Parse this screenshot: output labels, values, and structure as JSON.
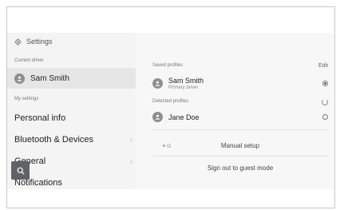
{
  "settings_title": "Settings",
  "sidebar": {
    "current_driver_label": "Current driver",
    "current_driver_name": "Sam Smith",
    "my_settings_label": "My settings",
    "items": [
      {
        "label": "Personal info",
        "chevron": false
      },
      {
        "label": "Bluetooth & Devices",
        "chevron": true
      },
      {
        "label": "General",
        "chevron": true
      },
      {
        "label": "Notifications",
        "chevron": false
      }
    ]
  },
  "main": {
    "saved_profiles_label": "Saved profiles",
    "edit_label": "Edit",
    "saved_profiles": [
      {
        "name": "Sam Smith",
        "subtitle": "Primary driver",
        "selected": true
      }
    ],
    "detected_profiles_label": "Detected profiles",
    "detected_profiles": [
      {
        "name": "Jane Doe",
        "selected": false
      }
    ],
    "manual_setup_label": "Manual setup",
    "sign_out_label": "Sign out to guest mode"
  },
  "icons": {
    "settings": "gear-icon",
    "avatar": "person-icon",
    "search": "search-icon",
    "manual_setup": "add-person-icon",
    "radio_selected": "radio-selected-icon",
    "radio_unselected": "radio-unselected-icon",
    "loading": "spinner-icon"
  }
}
